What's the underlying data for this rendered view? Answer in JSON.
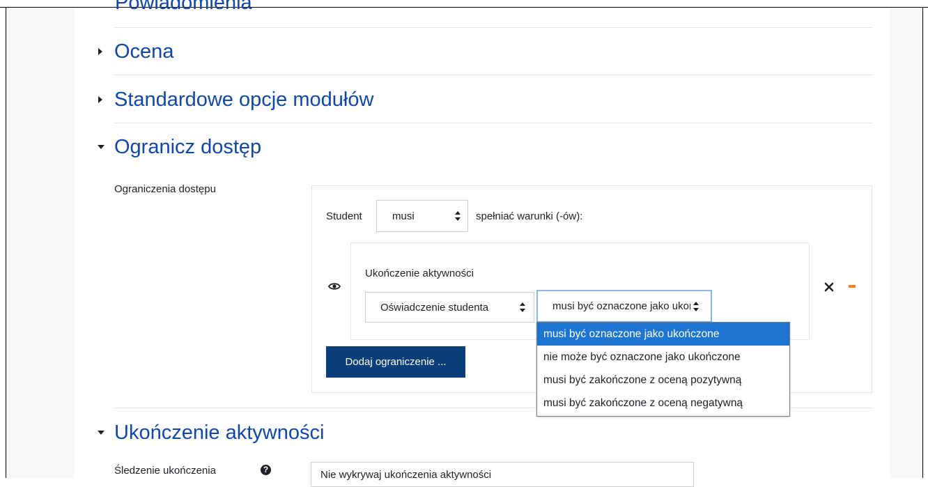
{
  "sections": {
    "notifications_partial": "Powiadomienia",
    "grade": "Ocena",
    "standard_module": "Standardowe opcje modułów",
    "restrict_access": "Ogranicz dostęp",
    "activity_completion": "Ukończenie aktywności"
  },
  "restrict": {
    "label": "Ograniczenia dostępu",
    "student_prefix": "Student",
    "must_select_value": "musi",
    "must_suffix": "spełniać warunki (-ów):",
    "condition_title": "Ukończenie aktywności",
    "activity_select_value": "Oświadczenie studenta",
    "state_select_value": "musi być oznaczone jako ukończone",
    "add_button": "Dodaj ograniczenie ..."
  },
  "dropdown": {
    "options": [
      "musi być oznaczone jako ukończone",
      "nie może być oznaczone jako ukończone",
      "musi być zakończone z oceną pozytywną",
      "musi być zakończone z oceną negatywną"
    ],
    "selected_index": 0
  },
  "completion": {
    "tracking_label": "Śledzenie ukończenia",
    "tracking_value": "Nie wykrywaj ukończenia aktywności"
  },
  "colors": {
    "link": "#0f47ad",
    "primary_button": "#0a3f7a",
    "selected_option": "#1e74d1",
    "minus_icon": "#f98012"
  }
}
